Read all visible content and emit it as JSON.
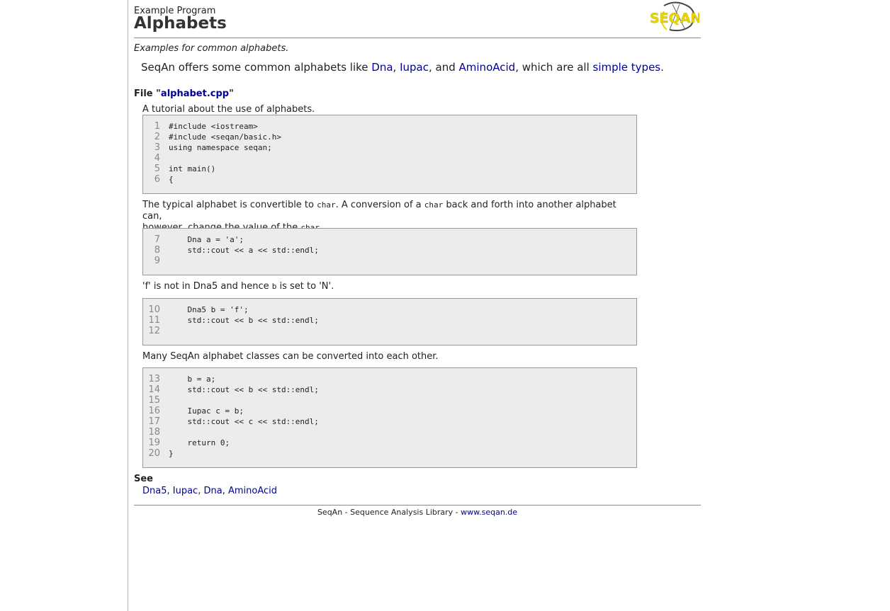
{
  "header": {
    "kicker": "Example Program",
    "title": "Alphabets",
    "logo_text": "SEQAN"
  },
  "subtitle": "Examples for common alphabets.",
  "intro": {
    "prefix": "SeqAn offers some common alphabets like ",
    "link_dna": "Dna",
    "sep1": ", ",
    "link_iupac": "Iupac",
    "sep2": ", and ",
    "link_aminoacid": "AminoAcid",
    "mid": ", which are all ",
    "link_simple_types": "simple types",
    "suffix": "."
  },
  "file": {
    "label_prefix": "File \"",
    "filename": "alphabet.cpp",
    "label_suffix": "\""
  },
  "sections": [
    {
      "description": "A tutorial about the use of alphabets.",
      "lines": [
        {
          "n": "1",
          "code": "#include <iostream>"
        },
        {
          "n": "2",
          "code": "#include <seqan/basic.h>"
        },
        {
          "n": "3",
          "code": "using namespace seqan;"
        },
        {
          "n": "4",
          "code": ""
        },
        {
          "n": "5",
          "code": "int main()"
        },
        {
          "n": "6",
          "code": "{"
        }
      ]
    },
    {
      "description_parts": [
        "The typical alphabet is convertible to ",
        "char",
        ". A conversion of a ",
        "char",
        " back and forth into another alphabet can,",
        "however, change the value of the ",
        "char",
        "."
      ],
      "lines": [
        {
          "n": "7",
          "code": "    Dna a = 'a';"
        },
        {
          "n": "8",
          "code": "    std::cout << a << std::endl;"
        },
        {
          "n": "9",
          "code": ""
        }
      ]
    },
    {
      "description_parts": [
        "'f' is not in Dna5 and hence ",
        "b",
        " is set to 'N'."
      ],
      "lines": [
        {
          "n": "10",
          "code": "    Dna5 b = 'f';"
        },
        {
          "n": "11",
          "code": "    std::cout << b << std::endl;"
        },
        {
          "n": "12",
          "code": ""
        }
      ]
    },
    {
      "description": "Many SeqAn alphabet classes can be converted into each other.",
      "lines": [
        {
          "n": "13",
          "code": "    b = a;"
        },
        {
          "n": "14",
          "code": "    std::cout << b << std::endl;"
        },
        {
          "n": "15",
          "code": ""
        },
        {
          "n": "16",
          "code": "    Iupac c = b;"
        },
        {
          "n": "17",
          "code": "    std::cout << c << std::endl;"
        },
        {
          "n": "18",
          "code": ""
        },
        {
          "n": "19",
          "code": "    return 0;"
        },
        {
          "n": "20",
          "code": "}"
        }
      ]
    }
  ],
  "see": {
    "title": "See",
    "links": [
      "Dna5",
      "Iupac",
      "Dna",
      "AminoAcid"
    ],
    "separator": ", "
  },
  "footer": {
    "text": "SeqAn - Sequence Analysis Library - ",
    "link": "www.seqan.de"
  },
  "colors": {
    "link": "#000099",
    "code_bg": "#ececec",
    "logo_yellow": "#e8d800"
  }
}
